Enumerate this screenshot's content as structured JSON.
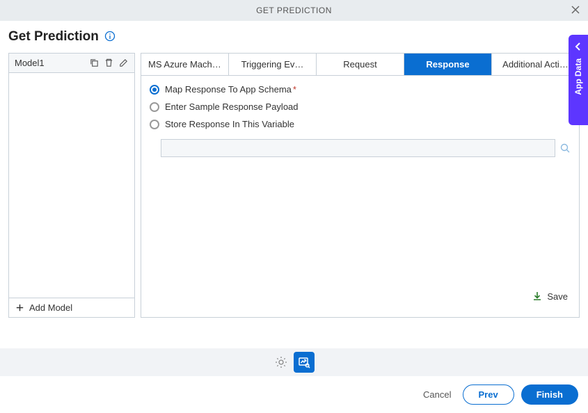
{
  "titlebar": {
    "title": "GET PREDICTION"
  },
  "header": {
    "title": "Get Prediction"
  },
  "sidebar": {
    "models": [
      {
        "name": "Model1"
      }
    ],
    "add_label": "Add Model"
  },
  "tabs": [
    {
      "label": "MS Azure Machine Lear…"
    },
    {
      "label": "Triggering Ev…"
    },
    {
      "label": "Request"
    },
    {
      "label": "Response"
    },
    {
      "label": "Additional Acti…"
    }
  ],
  "response": {
    "opt_map": "Map Response To App Schema",
    "opt_sample": "Enter Sample Response Payload",
    "opt_store": "Store Response In This Variable",
    "variable_value": "",
    "save_label": "Save"
  },
  "side_panel": {
    "label": "App Data"
  },
  "footer": {
    "cancel": "Cancel",
    "prev": "Prev",
    "finish": "Finish"
  }
}
